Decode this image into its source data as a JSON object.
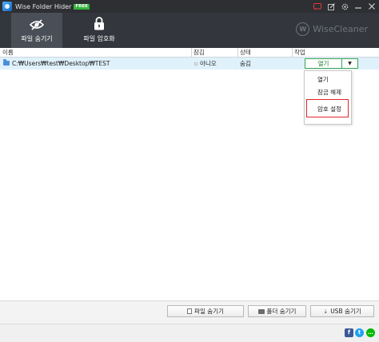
{
  "window": {
    "title": "Wise Folder Hider",
    "badge": "FREE"
  },
  "toolbar": {
    "tab_hide_file": "파일 숨기기",
    "tab_encrypt_file": "파일 암호화",
    "brand": "WiseCleaner"
  },
  "columns": {
    "name": "이름",
    "lock": "잠김",
    "status": "상태",
    "action": "작업"
  },
  "rows": [
    {
      "path": "C:₩Users₩test₩Desktop₩TEST",
      "locked": "아니오",
      "status": "숨김",
      "action_label": "열기",
      "dropdown_arrow": "▼"
    }
  ],
  "menu": {
    "items": [
      "열기",
      "잠금 해제",
      "암호 설정"
    ],
    "highlighted": "암호 설정"
  },
  "buttons": {
    "hide_file": "파일 숨기기",
    "hide_folder": "폴더 숨기기",
    "hide_usb": "USB 숨기기"
  },
  "colors": {
    "title_bar": "#2d2f33",
    "toolbar": "#33363c",
    "active_tab": "#4a4e56",
    "selected_row": "#dff1fb",
    "accent_green": "#3aa655",
    "highlight_red": "#e0262c",
    "free_badge": "#35b43b"
  },
  "icons": {
    "tab1": "eye-hidden-icon",
    "tab2": "lock-icon",
    "footer": [
      "facebook-icon",
      "twitter-icon",
      "chat-icon"
    ]
  }
}
